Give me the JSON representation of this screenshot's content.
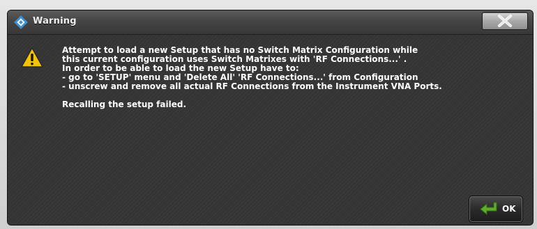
{
  "window": {
    "title": "Warning",
    "close_symbol": "X",
    "icon": "app-logo-icon"
  },
  "message": {
    "icon": "warning-triangle-icon",
    "lines": [
      "Attempt to load a new Setup that has no Switch Matrix Configuration while",
      "this current configuration uses Switch Matrixes with 'RF Connections...' .",
      "In order to be able to load the new Setup have to:",
      "- go to 'SETUP' menu and 'Delete All' 'RF Connections...' from Configuration",
      "- unscrew and remove all actual RF Connections from the Instrument VNA Ports."
    ],
    "status": "Recalling the setup failed."
  },
  "buttons": {
    "ok_label": "OK",
    "ok_icon": "enter-arrow-icon"
  },
  "colors": {
    "warning_yellow": "#f5c400",
    "ok_arrow_green": "#5fae2b",
    "logo_blue": "#3c8fd0"
  }
}
